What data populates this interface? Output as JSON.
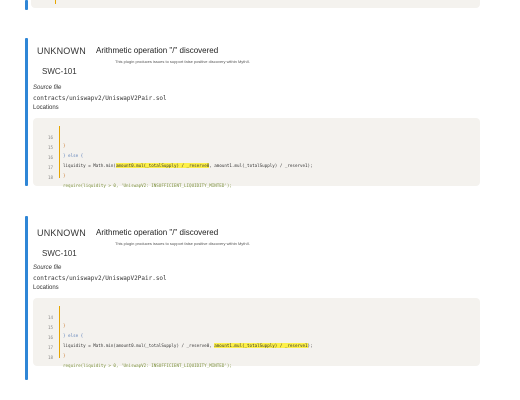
{
  "findings": [
    {
      "severity": "UNKNOWN",
      "swc": "SWC-101",
      "title": "Arithmetic operation \"/\" discovered",
      "description": "This plugin produces issues to support false positive discovery within MythX.",
      "source_label": "Source file",
      "source_path": "contracts/uniswapv2/UniswapV2Pair.sol",
      "locations_label": "Locations",
      "code": [
        {
          "num": "16",
          "pre": "}",
          "hl": "",
          "post": ""
        },
        {
          "num": "15",
          "pre": "} else {",
          "hl": "",
          "post": ""
        },
        {
          "num": "16",
          "pre": "liquidity = Math.min(",
          "hl": "amount0.mul(_totalSupply) / _reserve0",
          "post": ", amount1.mul(_totalSupply) / _reserve1);"
        },
        {
          "num": "17",
          "pre": "}",
          "hl": "",
          "post": ""
        },
        {
          "num": "18",
          "pre": "require(liquidity > 0, 'UniswapV2: INSUFFICIENT_LIQUIDITY_MINTED');",
          "hl": "",
          "post": ""
        }
      ]
    },
    {
      "severity": "UNKNOWN",
      "swc": "SWC-101",
      "title": "Arithmetic operation \"/\" discovered",
      "description": "This plugin produces issues to support false positive discovery within MythX.",
      "source_label": "Source file",
      "source_path": "contracts/uniswapv2/UniswapV2Pair.sol",
      "locations_label": "Locations",
      "code": [
        {
          "num": "14",
          "pre": "}",
          "hl": "",
          "post": ""
        },
        {
          "num": "15",
          "pre": "} else {",
          "hl": "",
          "post": ""
        },
        {
          "num": "16",
          "pre": "liquidity = Math.min(amount0.mul(_totalSupply) / _reserve0, ",
          "hl": "amount1.mul(_totalSupply) / _reserve1",
          "post": ");"
        },
        {
          "num": "17",
          "pre": "}",
          "hl": "",
          "post": ""
        },
        {
          "num": "18",
          "pre": "require(liquidity > 0, 'UniswapV2: INSUFFICIENT_LIQUIDITY_MINTED');",
          "hl": "",
          "post": ""
        }
      ]
    }
  ]
}
